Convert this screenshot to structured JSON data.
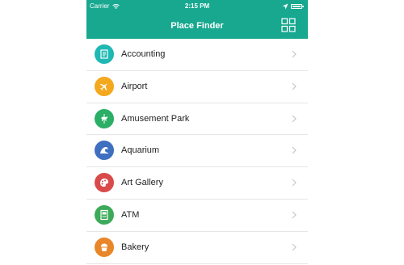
{
  "status_bar": {
    "carrier": "Carrier",
    "time": "2:15 PM"
  },
  "nav": {
    "title": "Place Finder"
  },
  "places": [
    {
      "label": "Accounting",
      "icon": "ledger-icon",
      "color": "#1FB8B3"
    },
    {
      "label": "Airport",
      "icon": "airplane-icon",
      "color": "#F4A81D"
    },
    {
      "label": "Amusement Park",
      "icon": "carousel-horse-icon",
      "color": "#2BAE66"
    },
    {
      "label": "Aquarium",
      "icon": "wave-icon",
      "color": "#3F6FBF"
    },
    {
      "label": "Art Gallery",
      "icon": "palette-icon",
      "color": "#D94B4B"
    },
    {
      "label": "ATM",
      "icon": "atm-machine-icon",
      "color": "#3DAA5A"
    },
    {
      "label": "Bakery",
      "icon": "cupcake-icon",
      "color": "#E8862A"
    }
  ],
  "colors": {
    "header": "#17A88F",
    "divider": "#E6E6E6",
    "chevron": "#C7C7CC"
  }
}
